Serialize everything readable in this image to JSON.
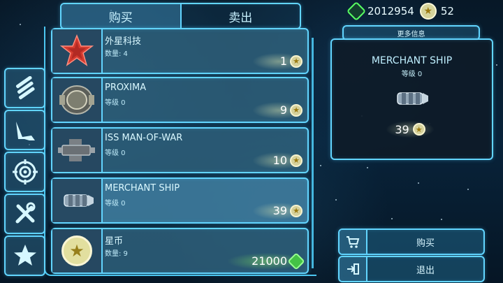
{
  "tabs": {
    "buy": "购买",
    "sell": "卖出"
  },
  "currency": {
    "green_amount": "2012954",
    "star_amount": "52"
  },
  "info": {
    "header": "更多信息",
    "ship_name": "MERCHANT SHIP",
    "level": "等级 0",
    "price": "39"
  },
  "items": [
    {
      "name": "外星科技",
      "sub": "数量: 4",
      "price": "1",
      "icon": "red-star-emblem"
    },
    {
      "name": "PROXIMA",
      "sub": "等级 0",
      "price": "9",
      "icon": "proxima-ship"
    },
    {
      "name": "ISS MAN-OF-WAR",
      "sub": "等级 0",
      "price": "10",
      "icon": "man-of-war-ship"
    },
    {
      "name": "MERCHANT SHIP",
      "sub": "等级 0",
      "price": "39",
      "icon": "merchant-ship"
    },
    {
      "name": "星币",
      "sub": "数量: 9",
      "price": "21000",
      "icon": "star-coin"
    }
  ],
  "actions": {
    "buy": "购买",
    "exit": "退出"
  }
}
